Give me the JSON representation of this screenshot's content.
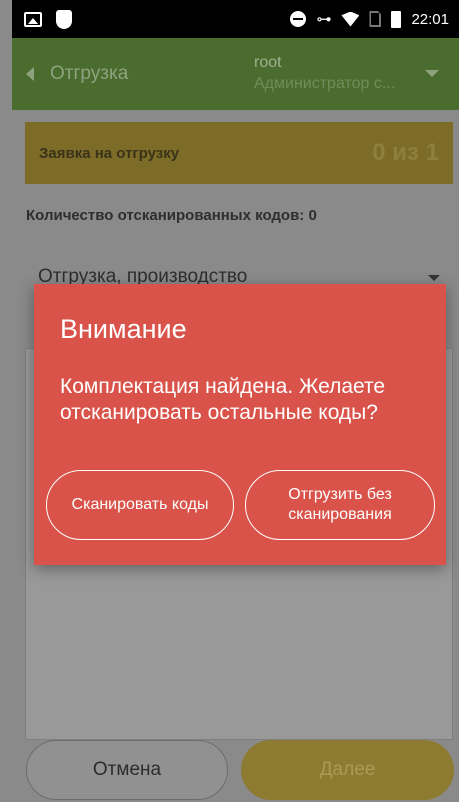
{
  "status_bar": {
    "time": "22:01",
    "icons": [
      "image-icon",
      "shield-icon",
      "do-not-disturb-icon",
      "vpn-key-icon",
      "wifi-icon",
      "no-sim-icon",
      "battery-icon"
    ]
  },
  "app_bar": {
    "title": "Отгрузка",
    "user_name": "root",
    "user_role": "Администратор с..."
  },
  "order": {
    "label": "Заявка на отгрузку",
    "count": "0 из 1"
  },
  "scanned_codes_label": "Количество отсканированных кодов: 0",
  "operation_select": {
    "value": "Отгрузка, производство"
  },
  "footer": {
    "cancel_label": "Отмена",
    "next_label": "Далее"
  },
  "dialog": {
    "title": "Внимание",
    "message": "Комплектация найдена. Желаете отсканировать остальные коды?",
    "scan_button": "Сканировать коды",
    "ship_button": "Отгрузить без сканирования"
  },
  "colors": {
    "app_bar": "#4a6c2e",
    "dialog": "#d9534a",
    "accent_yellow": "#8c7b30"
  }
}
